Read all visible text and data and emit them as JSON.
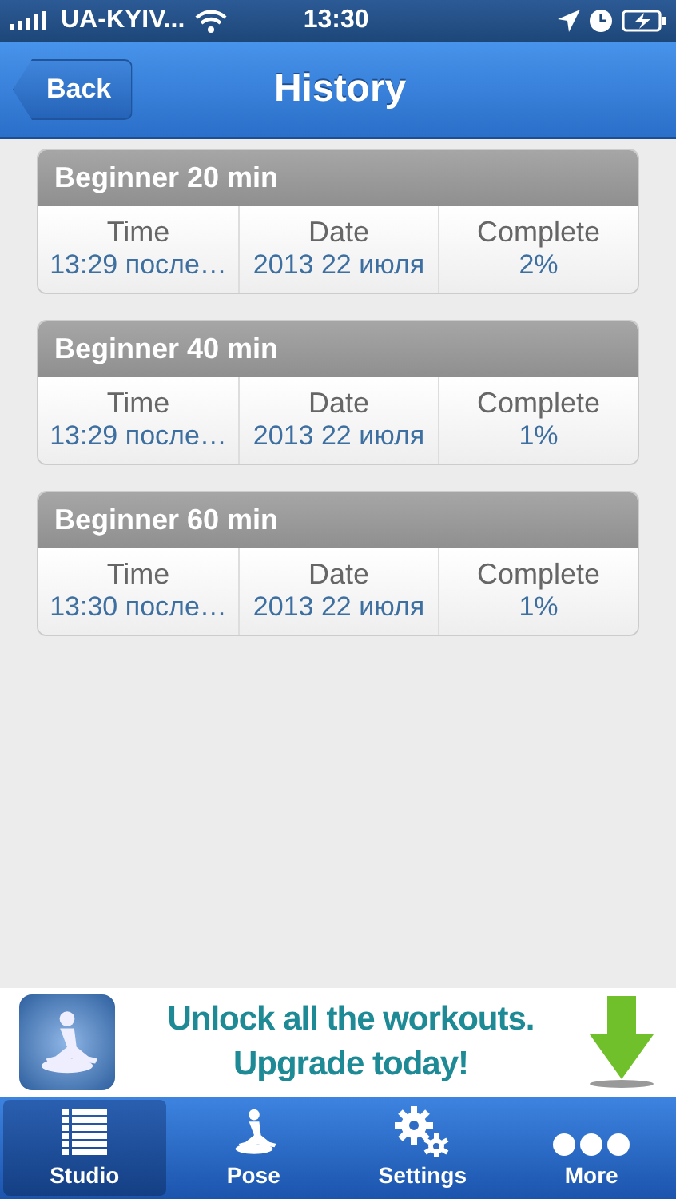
{
  "status_bar": {
    "carrier": "UA-KYIV...",
    "time": "13:30"
  },
  "nav_bar": {
    "back": "Back",
    "title": "History"
  },
  "sessions": [
    {
      "title": "Beginner 20 min",
      "columns": [
        {
          "label": "Time",
          "value": "13:29 после…"
        },
        {
          "label": "Date",
          "value": "2013 22 июля"
        },
        {
          "label": "Complete",
          "value": "2%"
        }
      ]
    },
    {
      "title": "Beginner 40 min",
      "columns": [
        {
          "label": "Time",
          "value": "13:29 после…"
        },
        {
          "label": "Date",
          "value": "2013 22 июля"
        },
        {
          "label": "Complete",
          "value": "1%"
        }
      ]
    },
    {
      "title": "Beginner 60 min",
      "columns": [
        {
          "label": "Time",
          "value": "13:30 после…"
        },
        {
          "label": "Date",
          "value": "2013 22 июля"
        },
        {
          "label": "Complete",
          "value": "1%"
        }
      ]
    }
  ],
  "ad_banner": {
    "lines": [
      "Unlock all the workouts.",
      "Upgrade today!"
    ]
  },
  "tabs": [
    {
      "label": "Studio",
      "kind": "list",
      "selected": true
    },
    {
      "label": "Pose",
      "kind": "pose",
      "selected": false
    },
    {
      "label": "Settings",
      "kind": "gears",
      "selected": false
    },
    {
      "label": "More",
      "kind": "dots",
      "selected": false
    }
  ]
}
